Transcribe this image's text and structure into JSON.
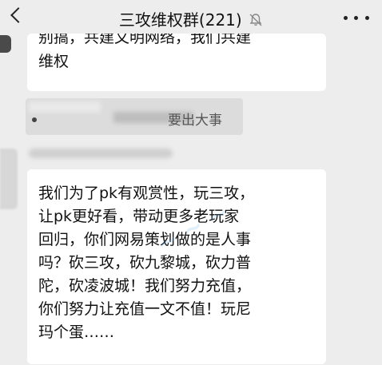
{
  "header": {
    "title": "三攻维权群(221)",
    "mute_icon": "bell-muted-icon",
    "more_icon": "more-dots-icon",
    "back_icon": "back-arrow-icon"
  },
  "messages": {
    "first": {
      "line1": "别搞，共建文明网络，我们共建",
      "line2": "维权"
    },
    "system": {
      "text": "要出大事"
    },
    "second": {
      "text": "我们为了pk有观赏性，玩三攻，\n让pk更好看，带动更多老玩家\n回归，你们网易策划做的是人事\n吗？砍三攻，砍九黎城，砍力普\n陀，砍凌波城！我们努力充值，\n你们努力让充值一文不值！玩尼\n玛个蛋……"
    }
  },
  "colors": {
    "background": "#ededed",
    "bubble": "#ffffff",
    "system_bg": "#dcdcdc"
  }
}
